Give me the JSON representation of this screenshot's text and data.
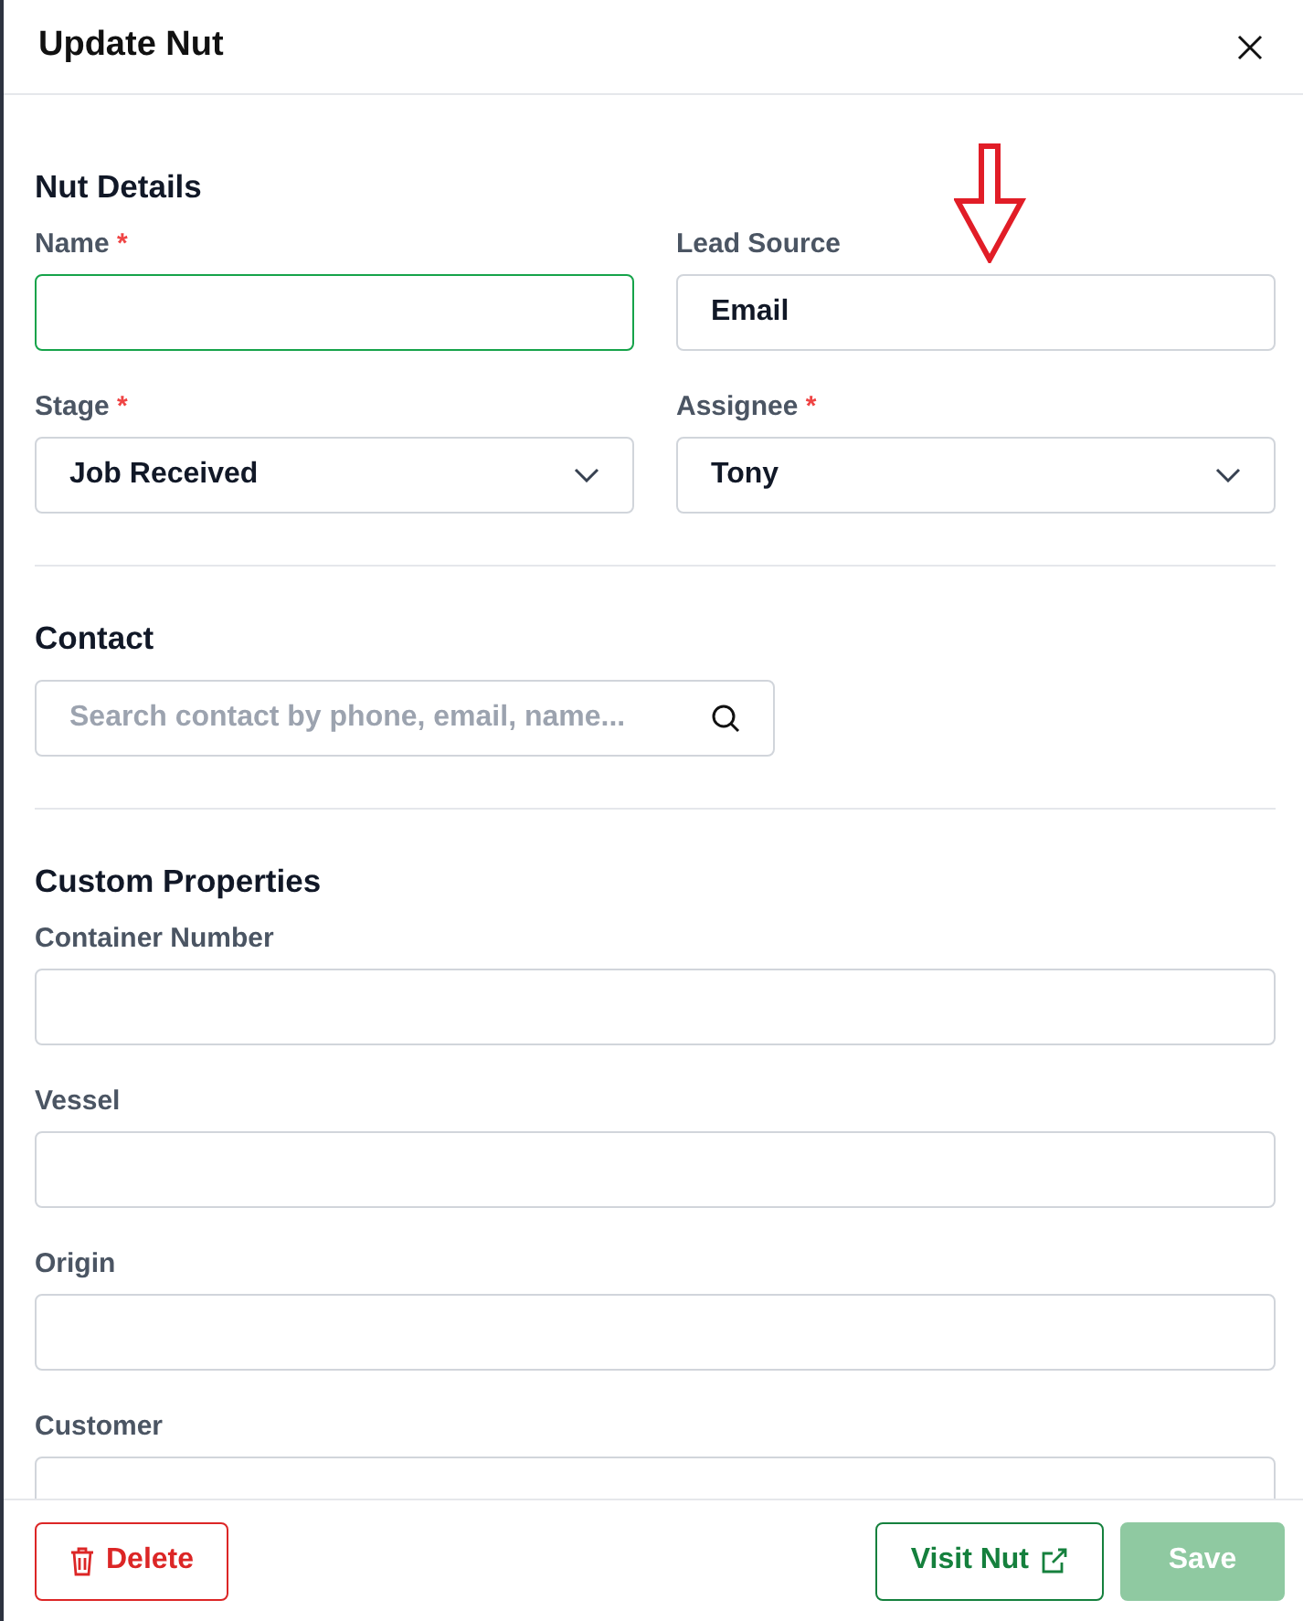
{
  "title": "Update Nut",
  "sections": [
    {
      "heading": "Nut Details",
      "rows": [
        [
          {
            "label": "Name",
            "required_mark": "*",
            "kind": "text",
            "focused": true
          },
          {
            "label": "Lead Source",
            "kind": "text",
            "value": "Email",
            "focused": false
          }
        ],
        [
          {
            "label": "Stage",
            "required_mark": "*",
            "kind": "select",
            "value": "Job Received",
            "focused": false
          },
          {
            "label": "Assignee",
            "required_mark": "*",
            "kind": "select",
            "value": "Tony",
            "focused": false
          }
        ]
      ]
    },
    {
      "heading": "Contact",
      "rows": [
        [
          {
            "kind": "search",
            "placeholder": "Search contact by phone, email, name...",
            "focused": false
          }
        ]
      ]
    },
    {
      "heading": "Custom Properties",
      "rows": [
        [
          {
            "label": "Container Number",
            "kind": "text",
            "focused": false
          }
        ],
        [
          {
            "label": "Vessel",
            "kind": "text",
            "focused": false
          }
        ],
        [
          {
            "label": "Origin",
            "kind": "text",
            "focused": false
          }
        ],
        [
          {
            "label": "Customer",
            "kind": "text",
            "focused": false
          }
        ]
      ]
    }
  ],
  "buttons": [
    {
      "label": "Delete",
      "kind": "delete"
    },
    {
      "label": "Visit Nut",
      "kind": "visit"
    },
    {
      "label": "Save",
      "kind": "save",
      "disabled": true
    }
  ]
}
